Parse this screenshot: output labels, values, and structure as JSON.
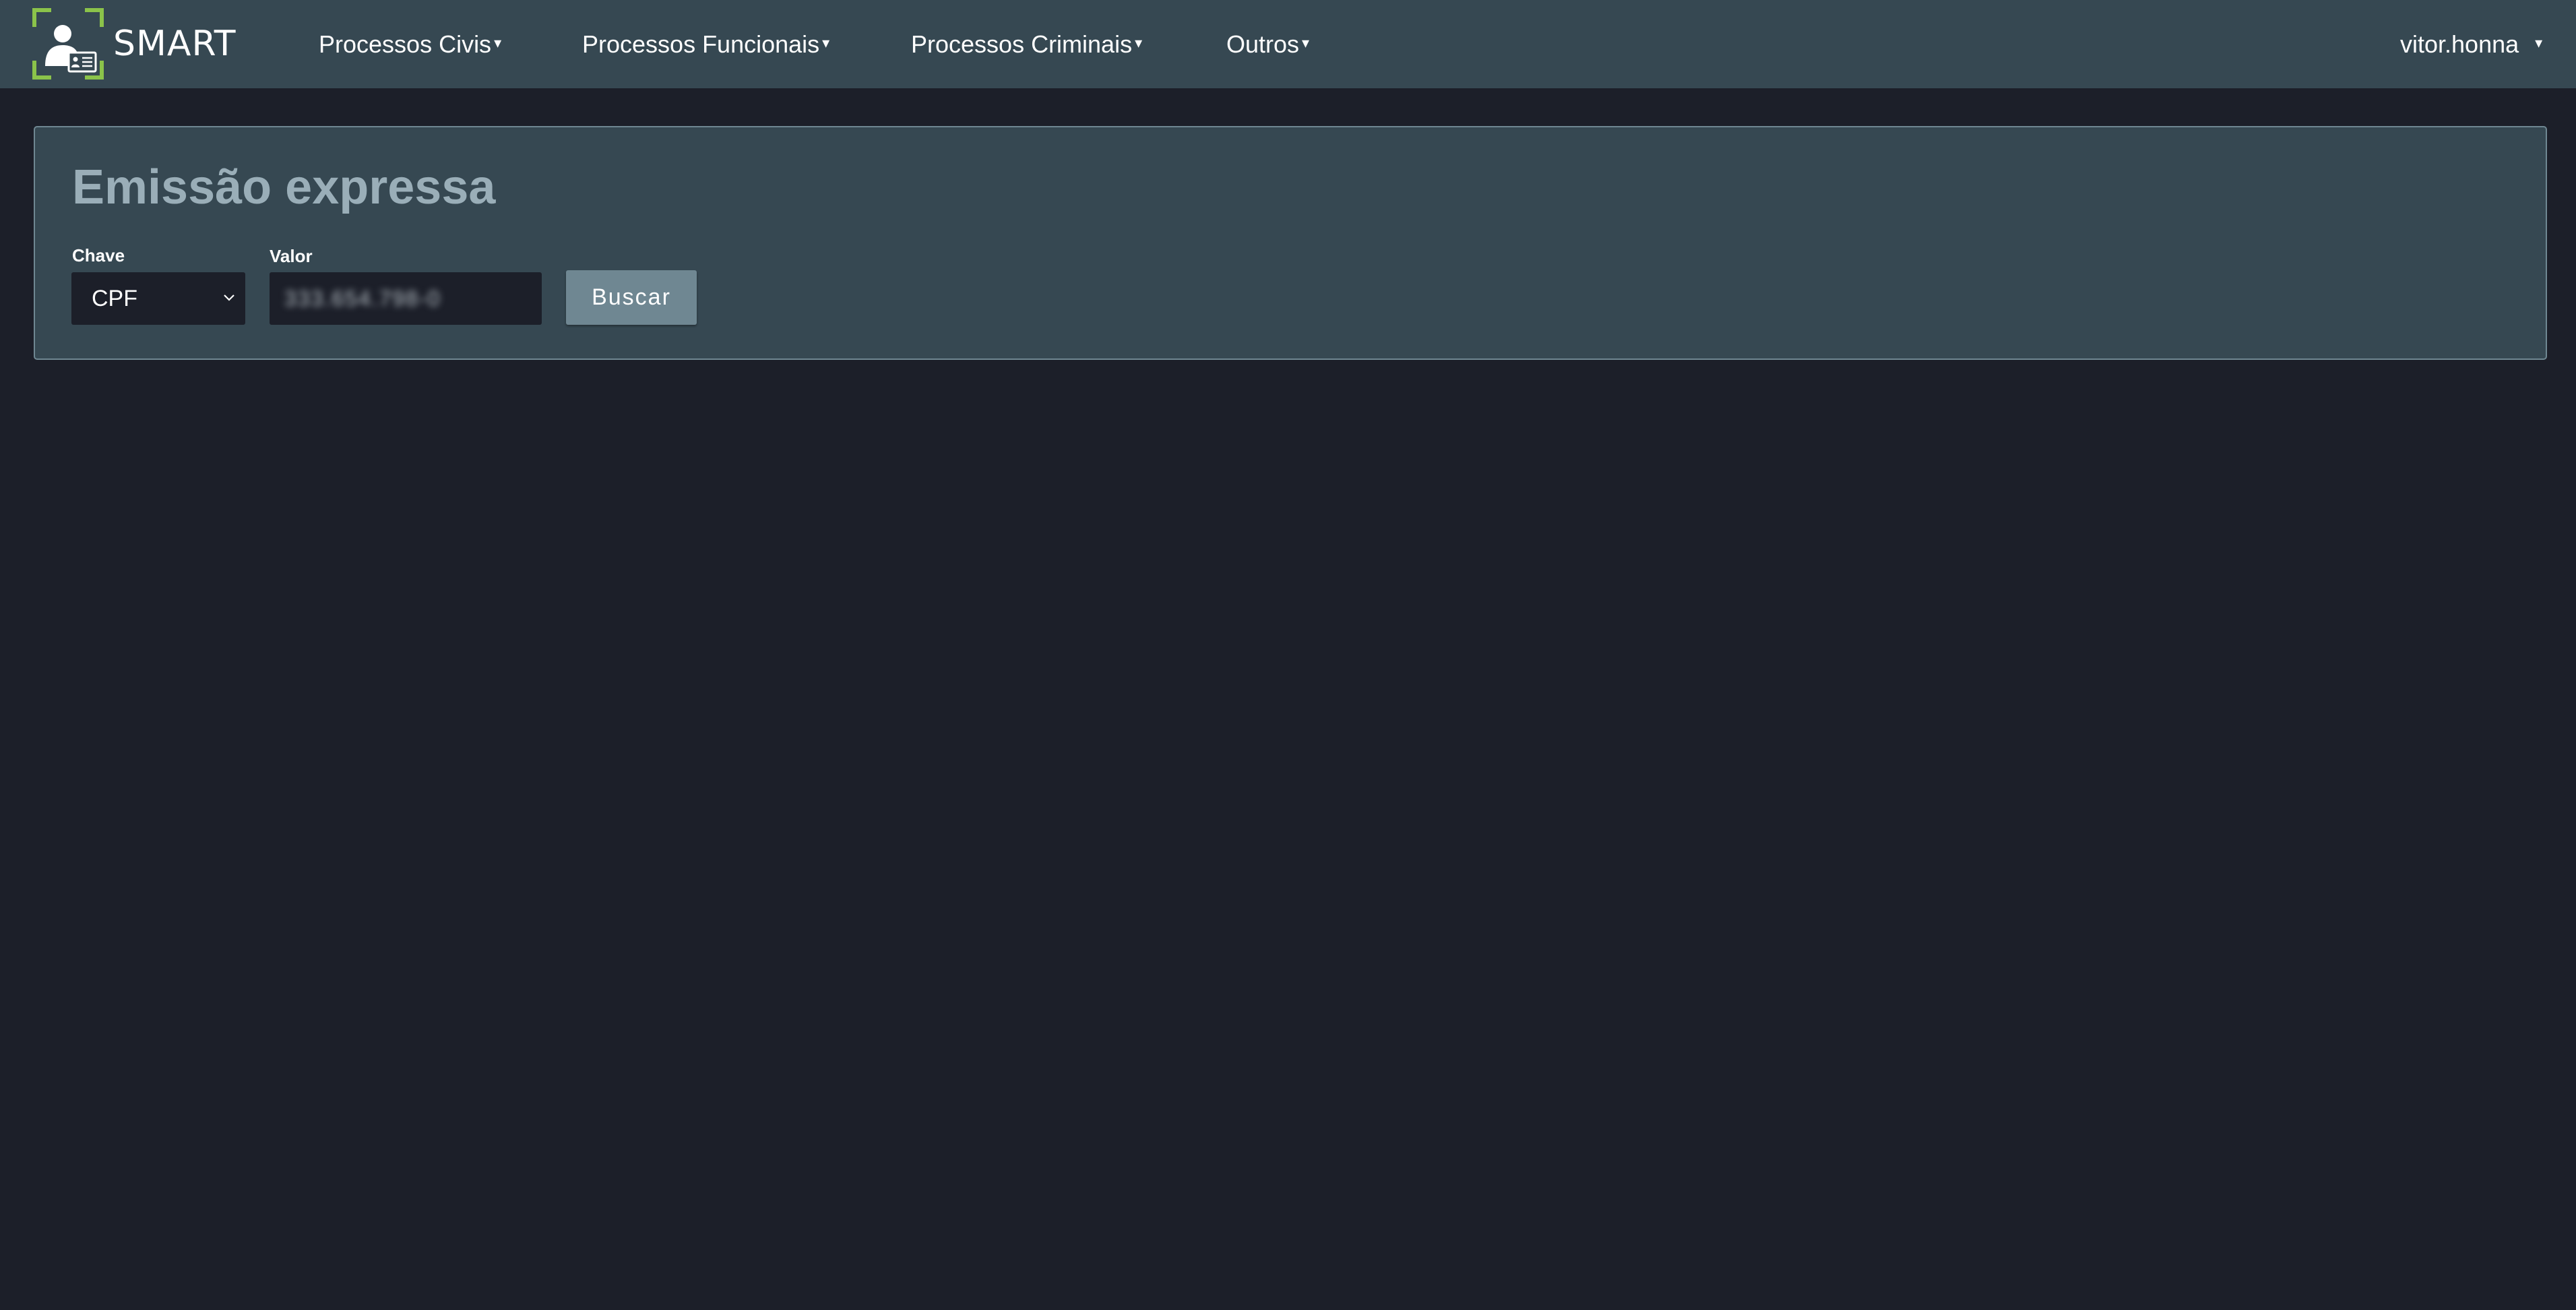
{
  "brand": {
    "name": "SMART",
    "logo_icon": "id-card-user-icon",
    "accent_color": "#8bc34a"
  },
  "nav": {
    "items": [
      {
        "label": "Processos Civis",
        "caret": "▾"
      },
      {
        "label": "Processos Funcionais",
        "caret": "▾"
      },
      {
        "label": "Processos Criminais",
        "caret": "▾"
      },
      {
        "label": "Outros",
        "caret": "▾"
      }
    ],
    "user": {
      "label": "vitor.honna",
      "caret": "▾"
    }
  },
  "panel": {
    "title": "Emissão expressa",
    "key_label": "Chave",
    "key_selected": "CPF",
    "value_label": "Valor",
    "value_text": "333.654.798-0",
    "search_label": "Buscar"
  },
  "colors": {
    "background": "#1c1f29",
    "navbar": "#364852",
    "panel": "#364852",
    "panel_border": "#6f8792",
    "title": "#9aaeb8",
    "button": "#6f8792"
  }
}
